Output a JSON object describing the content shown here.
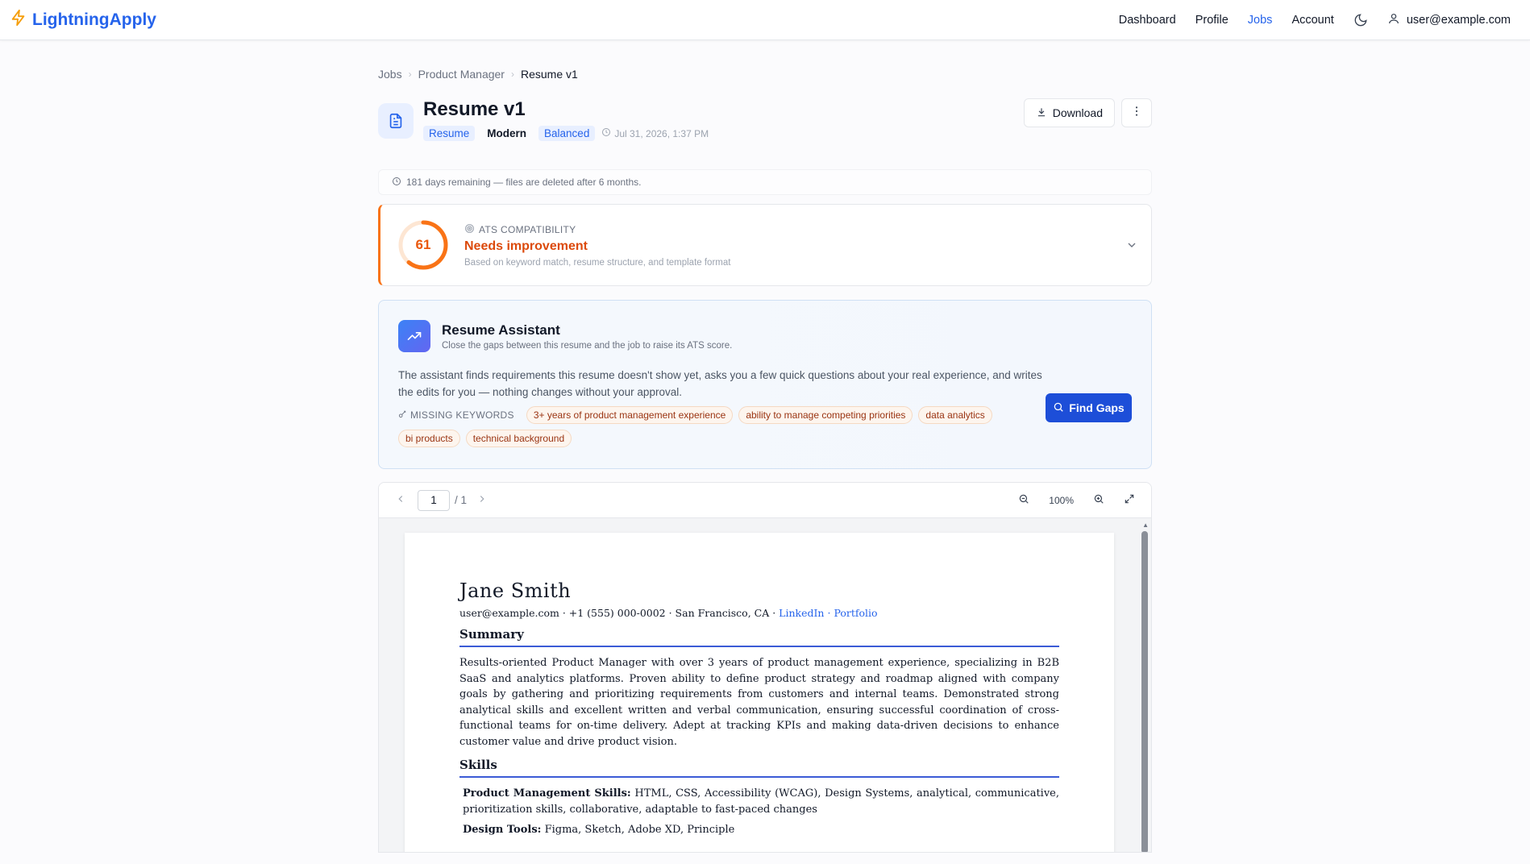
{
  "nav": {
    "brand": "LightningApply",
    "links": [
      "Dashboard",
      "Profile",
      "Jobs",
      "Account"
    ],
    "active": "Jobs",
    "user_email": "user@example.com",
    "brand_color": "#2563eb"
  },
  "breadcrumb": [
    "Jobs",
    "Product Manager",
    "Resume v1"
  ],
  "header": {
    "title": "Resume v1",
    "tag_type": "Resume",
    "tag_template": "Modern",
    "tag_style": "Balanced",
    "date": "Jul 31, 2026, 1:37 PM",
    "download_label": "Download"
  },
  "retention": {
    "text": "181 days remaining — files are deleted after 6 months."
  },
  "ats": {
    "score": "61",
    "score_value": 61,
    "label": "ATS COMPATIBILITY",
    "status": "Needs improvement",
    "subtitle": "Based on keyword match, resume structure, and template format",
    "accent_color": "#f97316"
  },
  "assistant": {
    "title": "Resume Assistant",
    "subtitle": "Close the gaps between this resume and the job to raise its ATS score.",
    "description": "The assistant finds requirements this resume doesn't show yet, asks you a few quick questions about your real experience, and writes the edits for you — nothing changes without your approval.",
    "keywords_label": "MISSING KEYWORDS",
    "keywords": [
      "3+ years of product management experience",
      "ability to manage competing priorities",
      "data analytics",
      "bi products",
      "technical background"
    ],
    "find_gaps_label": "Find Gaps"
  },
  "viewer": {
    "page_current": "1",
    "page_total": "/ 1",
    "zoom": "100%"
  },
  "resume": {
    "name": "Jane Smith",
    "contact": "user@example.com · +1 (555) 000-0002 · San Francisco, CA ·",
    "link_linkedin": "LinkedIn",
    "link_sep": "·",
    "link_portfolio": "Portfolio",
    "summary_heading": "Summary",
    "summary": "Results-oriented Product Manager with over 3 years of product management experience, specializing in B2B SaaS and analytics platforms. Proven ability to define product strategy and roadmap aligned with company goals by gathering and prioritizing requirements from customers and internal teams. Demonstrated strong analytical skills and excellent written and verbal communication, ensuring successful coordination of cross-functional teams for on-time delivery. Adept at tracking KPIs and making data-driven decisions to enhance customer value and drive product vision.",
    "skills_heading": "Skills",
    "skills": [
      {
        "label": "Product Management Skills:",
        "value": "HTML, CSS, Accessibility (WCAG), Design Systems, analytical, communicative, prioritization skills, collaborative, adaptable to fast-paced changes"
      },
      {
        "label": "Design Tools:",
        "value": "Figma, Sketch, Adobe XD, Principle"
      }
    ]
  }
}
